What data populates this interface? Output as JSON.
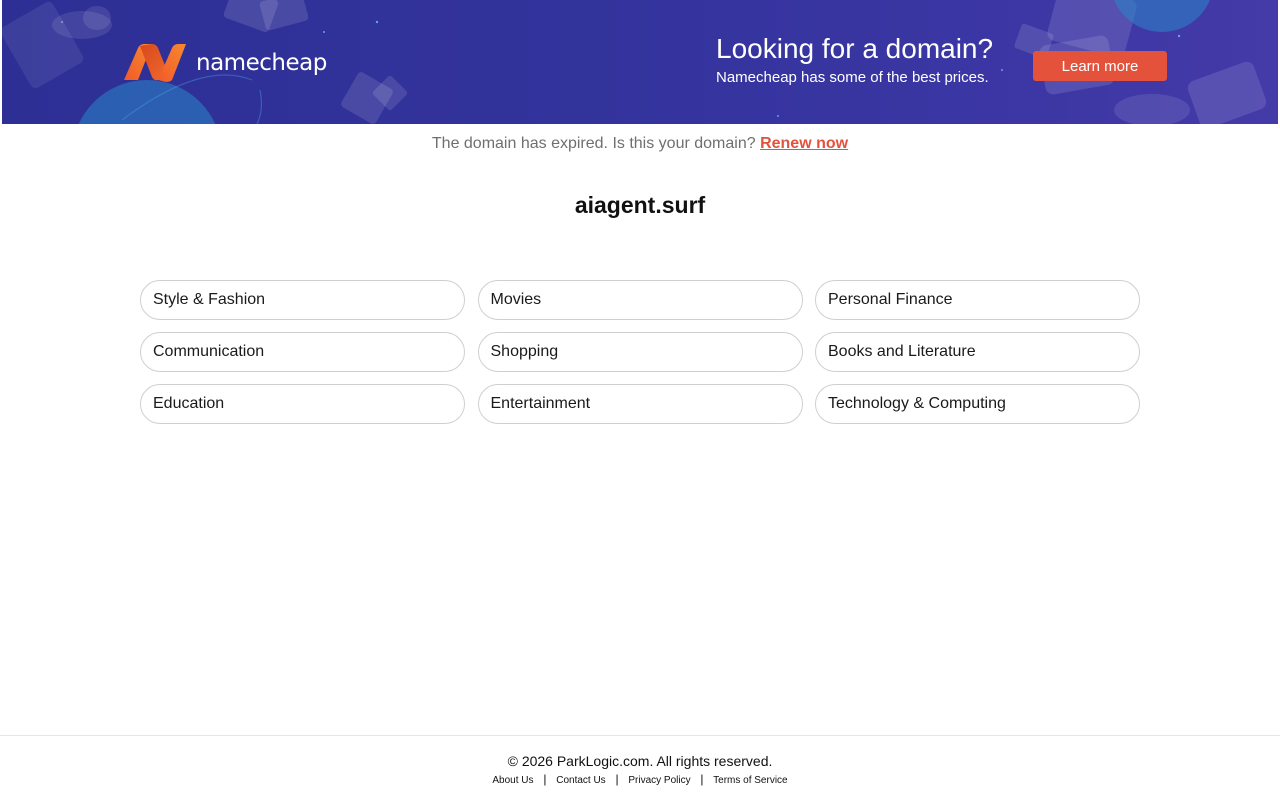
{
  "banner": {
    "logo_icon": "namecheap-logo-icon",
    "logo_text": "namecheap",
    "promo_title": "Looking for a domain?",
    "promo_subtitle": "Namecheap has some of the best prices.",
    "learn_more_label": "Learn more",
    "colors": {
      "background": "#33339c",
      "accent": "#e4523b",
      "logo_orange": "#f26a2f"
    }
  },
  "notice": {
    "text": "The domain has expired. Is this your domain?",
    "renew_label": "Renew now"
  },
  "domain": {
    "name": "aiagent.surf"
  },
  "categories": [
    "Style & Fashion",
    "Movies",
    "Personal Finance",
    "Communication",
    "Shopping",
    "Books and Literature",
    "Education",
    "Entertainment",
    "Technology & Computing"
  ],
  "footer": {
    "copyright": "© 2026 ParkLogic.com. All rights reserved.",
    "links": [
      "About Us",
      "Contact Us",
      "Privacy Policy",
      "Terms of Service"
    ],
    "separator": "|"
  }
}
